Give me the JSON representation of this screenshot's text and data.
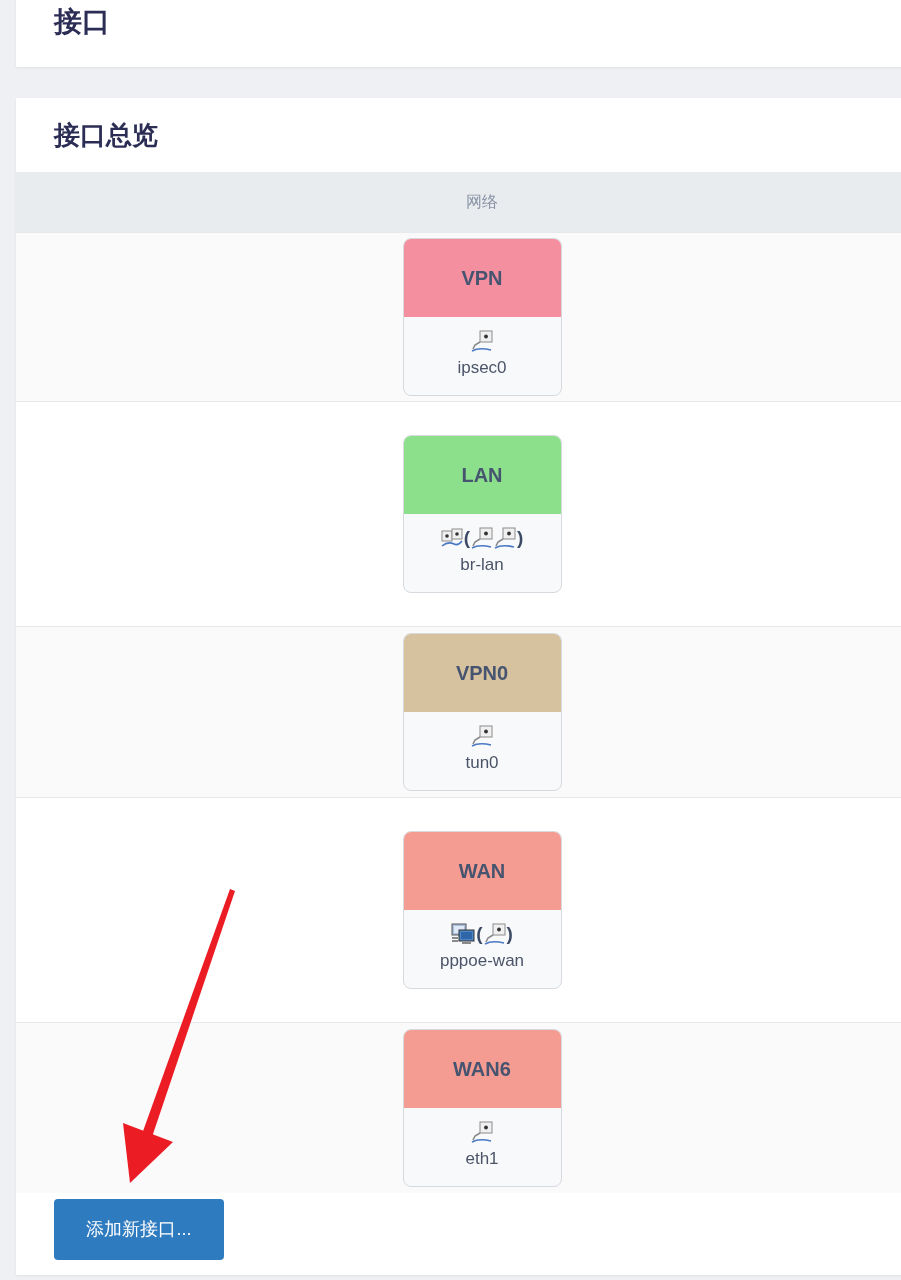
{
  "page": {
    "title": "接口"
  },
  "overview": {
    "title": "接口总览",
    "columns": [
      "网络"
    ],
    "interfaces": [
      {
        "name": "VPN",
        "color": "#f48fa0",
        "devices": [
          {
            "kind": "port"
          }
        ],
        "device_name": "ipsec0"
      },
      {
        "name": "LAN",
        "color": "#8ce08c",
        "devices": [
          {
            "kind": "bridge"
          },
          {
            "kind": "text",
            "text": "("
          },
          {
            "kind": "port"
          },
          {
            "kind": "port"
          },
          {
            "kind": "text",
            "text": ")"
          }
        ],
        "device_name": "br-lan"
      },
      {
        "name": "VPN0",
        "color": "#d7c29f",
        "devices": [
          {
            "kind": "port"
          }
        ],
        "device_name": "tun0"
      },
      {
        "name": "WAN",
        "color": "#f59c92",
        "devices": [
          {
            "kind": "computers"
          },
          {
            "kind": "text",
            "text": "("
          },
          {
            "kind": "port"
          },
          {
            "kind": "text",
            "text": ")"
          }
        ],
        "device_name": "pppoe-wan"
      },
      {
        "name": "WAN6",
        "color": "#f59c92",
        "devices": [
          {
            "kind": "port"
          }
        ],
        "device_name": "eth1"
      }
    ],
    "add_button": "添加新接口..."
  },
  "annotations": [
    {
      "kind": "arrow"
    }
  ]
}
